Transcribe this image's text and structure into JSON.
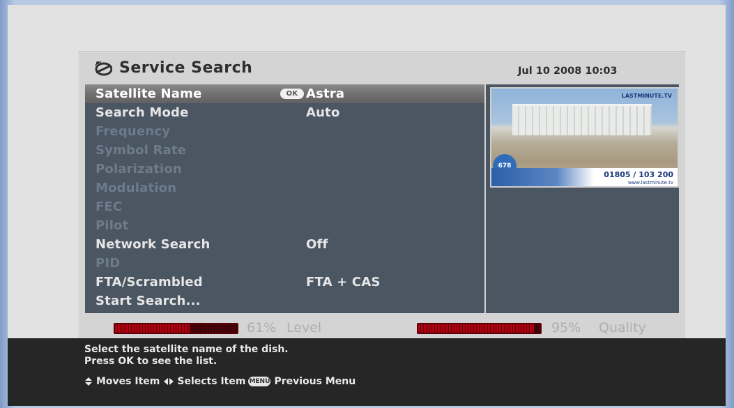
{
  "header": {
    "title": "Service Search",
    "datetime": "Jul 10 2008 10:03"
  },
  "menu": {
    "ok_badge": "OK",
    "items": [
      {
        "label": "Satellite Name",
        "value": "Astra",
        "state": "selected"
      },
      {
        "label": "Search Mode",
        "value": "Auto",
        "state": "enabled"
      },
      {
        "label": "Frequency",
        "value": "",
        "state": "disabled"
      },
      {
        "label": "Symbol Rate",
        "value": "",
        "state": "disabled"
      },
      {
        "label": "Polarization",
        "value": "",
        "state": "disabled"
      },
      {
        "label": "Modulation",
        "value": "",
        "state": "disabled"
      },
      {
        "label": "FEC",
        "value": "",
        "state": "disabled"
      },
      {
        "label": "Pilot",
        "value": "",
        "state": "disabled"
      },
      {
        "label": "Network Search",
        "value": "Off",
        "state": "enabled"
      },
      {
        "label": "PID",
        "value": "",
        "state": "disabled"
      },
      {
        "label": "FTA/Scrambled",
        "value": "FTA + CAS",
        "state": "enabled"
      },
      {
        "label": "Start Search...",
        "value": "",
        "state": "enabled"
      }
    ]
  },
  "preview": {
    "brand": "LASTMINUTE.TV",
    "badge_number": "678",
    "phone": "01805 / 103 200",
    "url": "www.lastminute.tv"
  },
  "signal": {
    "level_value": 61,
    "level_text": "61%",
    "level_label": "Level",
    "quality_value": 95,
    "quality_text": "95%",
    "quality_label": "Quality"
  },
  "help": {
    "line1": "Select the satellite name of the dish.",
    "line2": "Press OK to see the list.",
    "moves": "Moves Item",
    "selects": "Selects Item",
    "menu_badge": "MENU",
    "previous": "Previous Menu"
  },
  "colors": {
    "menu_bg": "#4b5663",
    "selected_row": "#7a7a7a",
    "bar_fill": "#b00010",
    "info_bar": "#262626"
  },
  "icons": [
    "satellite-icon",
    "up-down-arrows-icon",
    "left-right-arrows-icon"
  ]
}
